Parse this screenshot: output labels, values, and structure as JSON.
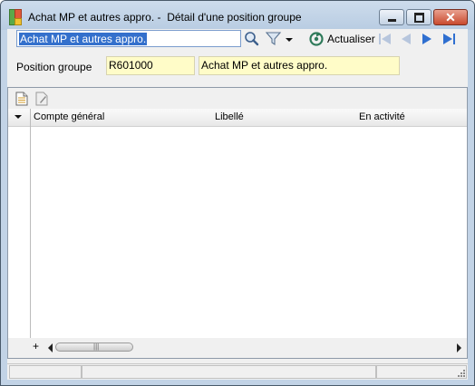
{
  "window": {
    "title": "Achat MP et autres appro. -  Détail d'une position groupe",
    "close_glyph": "✕"
  },
  "toolbar": {
    "search_value": "Achat MP et autres appro.",
    "refresh_label": "Actualiser"
  },
  "form": {
    "position_label": "Position groupe",
    "position_code": "R601000",
    "position_libelle": "Achat MP et autres appro."
  },
  "grid": {
    "columns": [
      "Compte général",
      "Libellé",
      "En activité"
    ],
    "rows": []
  },
  "scrollbar": {
    "add_glyph": "+"
  }
}
